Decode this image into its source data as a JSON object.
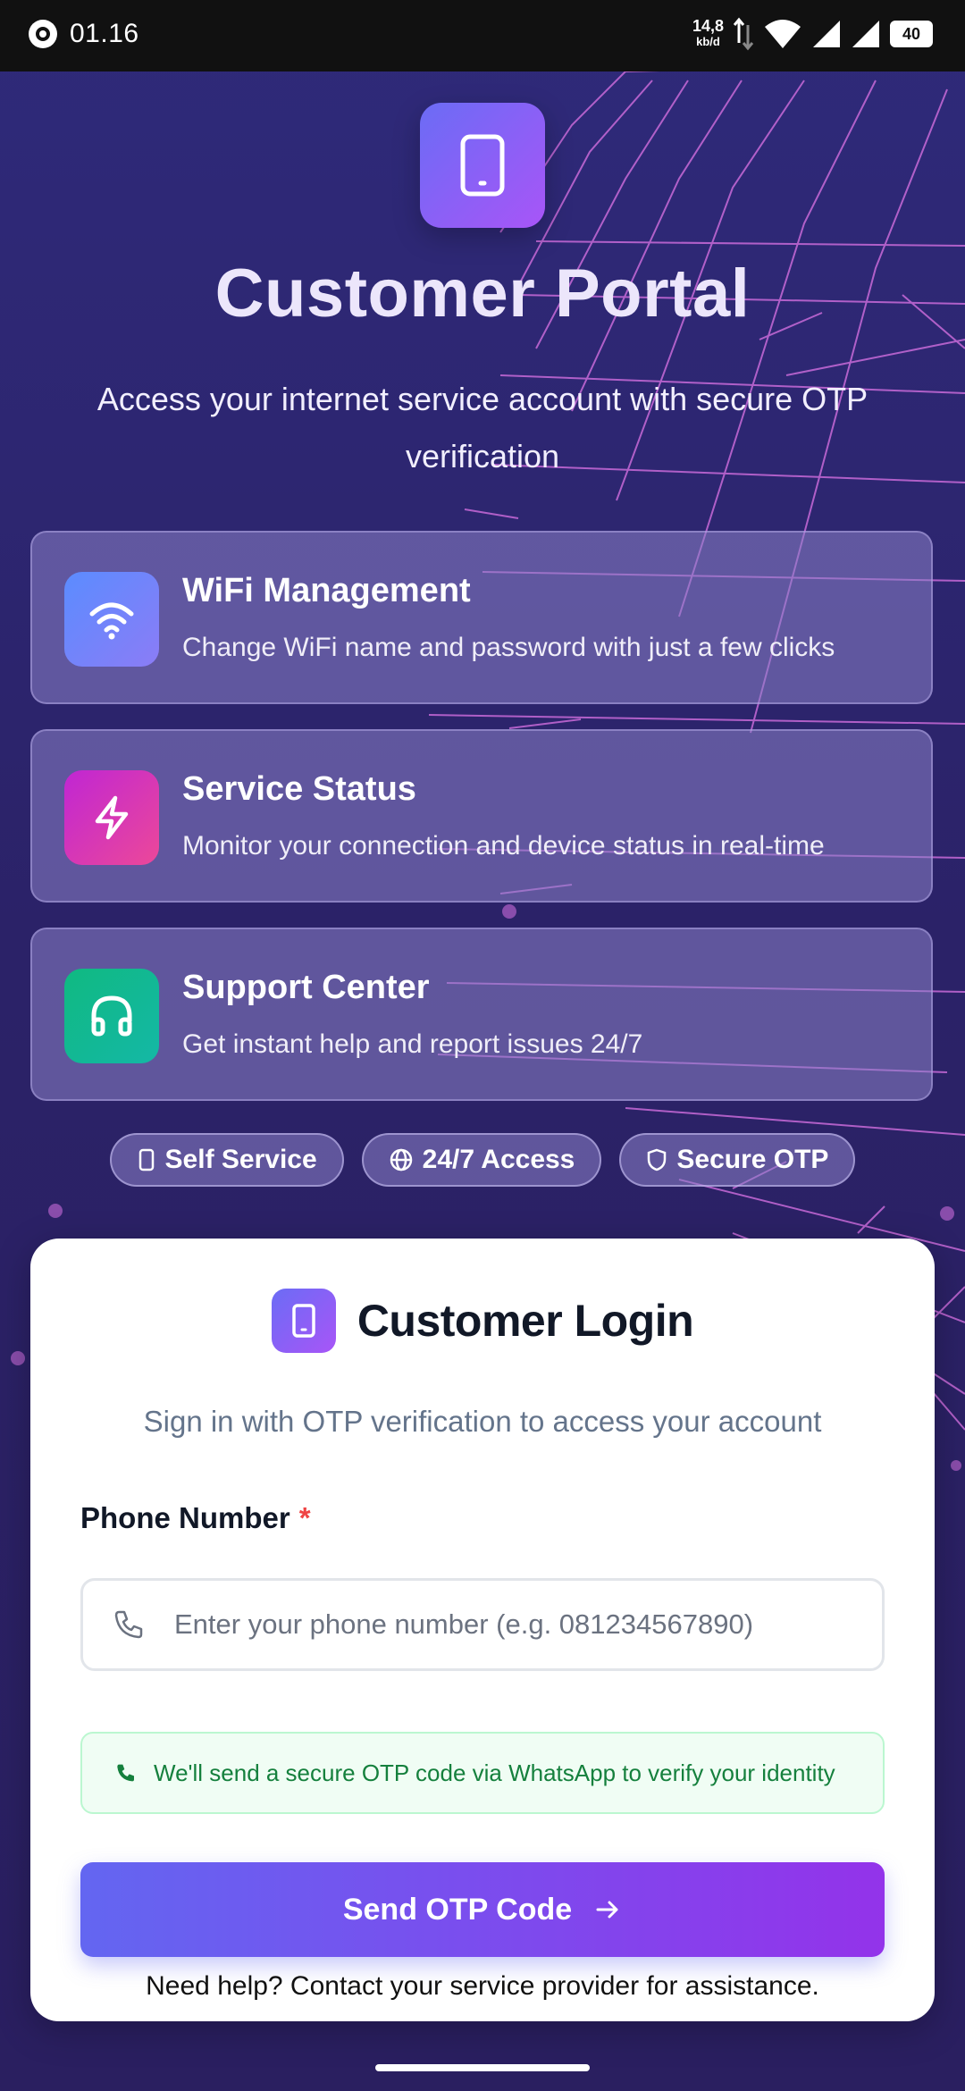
{
  "status_bar": {
    "time": "01.16",
    "net_speed": "14,8",
    "net_unit": "kb/d",
    "battery": "40"
  },
  "hero": {
    "title": "Customer Portal",
    "subtitle": "Access your internet service account with secure OTP verification",
    "icon": "smartphone-icon"
  },
  "features": [
    {
      "title": "WiFi Management",
      "desc": "Change WiFi name and password with just a few clicks",
      "icon": "wifi-icon",
      "color": "#5b8cff"
    },
    {
      "title": "Service Status",
      "desc": "Monitor your connection and device status in real-time",
      "icon": "zap-icon",
      "color": "#d946ef"
    },
    {
      "title": "Support Center",
      "desc": "Get instant help and report issues 24/7",
      "icon": "headphones-icon",
      "color": "#10b981"
    }
  ],
  "chips": [
    {
      "label": "Self Service",
      "icon": "smartphone-icon"
    },
    {
      "label": "24/7 Access",
      "icon": "globe-icon"
    },
    {
      "label": "Secure OTP",
      "icon": "shield-icon"
    }
  ],
  "login": {
    "title": "Customer Login",
    "subtitle": "Sign in with OTP verification to access your account",
    "phone_label": "Phone Number",
    "required_mark": "*",
    "phone_placeholder": "Enter your phone number (e.g. 081234567890)",
    "phone_value": "",
    "info_text": "We'll send a secure OTP code via WhatsApp to verify your identity",
    "send_button": "Send OTP Code",
    "help_text": "Need help? Contact your service provider for assistance."
  },
  "colors": {
    "accent_start": "#6366f1",
    "accent_end": "#9333ea",
    "background": "#2e2470",
    "success": "#15803d"
  }
}
